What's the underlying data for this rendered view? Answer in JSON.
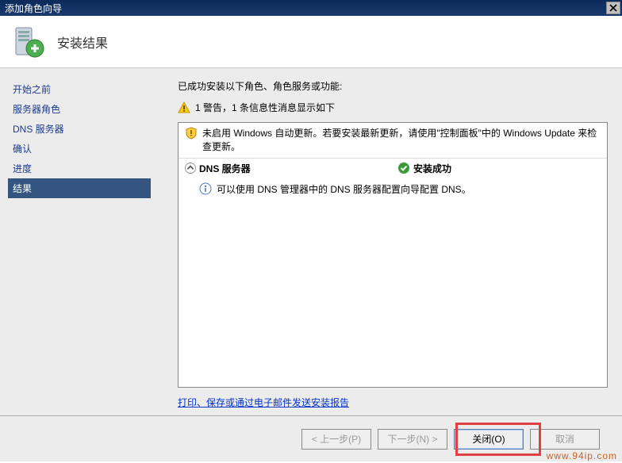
{
  "window": {
    "title": "添加角色向导"
  },
  "header": {
    "title": "安装结果"
  },
  "sidebar": {
    "items": [
      {
        "label": "开始之前"
      },
      {
        "label": "服务器角色"
      },
      {
        "label": "DNS 服务器"
      },
      {
        "label": "确认"
      },
      {
        "label": "进度"
      },
      {
        "label": "结果",
        "active": true
      }
    ]
  },
  "content": {
    "intro": "已成功安装以下角色、角色服务或功能:",
    "warning_summary": "1 警告，1 条信息性消息显示如下",
    "update_warning": "未启用 Windows 自动更新。若要安装最新更新，请使用\"控制面板\"中的 Windows Update 来检查更新。",
    "role": {
      "name": "DNS 服务器",
      "status": "安装成功",
      "info": "可以使用 DNS 管理器中的 DNS 服务器配置向导配置 DNS。"
    },
    "report_link": "打印、保存或通过电子邮件发送安装报告"
  },
  "buttons": {
    "prev": "< 上一步(P)",
    "next": "下一步(N) >",
    "close": "关闭(O)",
    "cancel": "取消"
  },
  "watermark": "www.94ip.com"
}
